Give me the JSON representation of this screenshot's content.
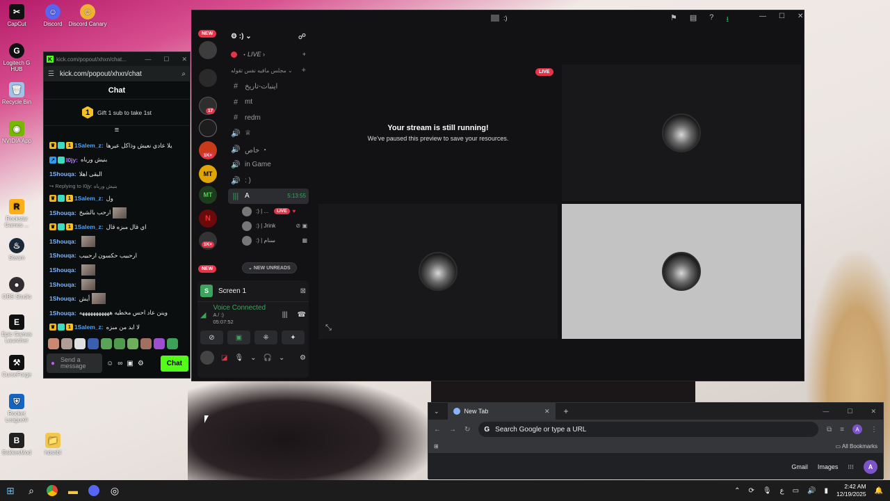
{
  "desktop": {
    "icons": [
      "CapCut",
      "Discord",
      "Discord Canary",
      "Logitech G HUB",
      "Recycle Bin",
      "NVIDIA App",
      "Rockstar Games ...",
      "Steam",
      "OBS Studio",
      "Epic Games Launcher",
      "CurseForge",
      "Rocket League®",
      "BakkesMod",
      "hdsnbl"
    ]
  },
  "kick": {
    "window_title": "kick.com/popout/xhxn/chat...",
    "url": "kick.com/popout/xhxn/chat",
    "chat_title": "Chat",
    "gift_count": "1",
    "gift_text": "Gift 1 sub to take 1st",
    "messages": [
      {
        "user": "1Salem_z:",
        "text": "يلا عادي نعيش وذاكل عيرها",
        "badges": true
      },
      {
        "user": "I0jy:",
        "text": "بنيش ورباه",
        "badges": true
      },
      {
        "user": "1Shouqa:",
        "text": "البقى اهلا"
      },
      {
        "user": "",
        "text": "Replying to I0jy: بنيش ورباه",
        "reply": true
      },
      {
        "user": "1Salem_z:",
        "text": "ول",
        "badges": true
      },
      {
        "user": "1Shouqa:",
        "text": "ارحب بالشيخ",
        "thumb": true
      },
      {
        "user": "1Salem_z:",
        "text": "اي قال مبزه قال",
        "badges": true
      },
      {
        "user": "1Shouqa:",
        "text": "",
        "thumb": true
      },
      {
        "user": "1Shouqa:",
        "text": "ارحبيب حكسون ارحبيب"
      },
      {
        "user": "1Shouqa:",
        "text": "",
        "thumb": true
      },
      {
        "user": "1Shouqa:",
        "text": "",
        "thumb": true
      },
      {
        "user": "1Shouqa:",
        "text": "أيش",
        "thumb": true
      },
      {
        "user": "1Shouqa:",
        "text": "وينن عاد احس مخطيه هههههههههههه"
      },
      {
        "user": "1Salem_z:",
        "text": "لا ابد من مبزه",
        "badges": true
      }
    ],
    "send_placeholder": "Send a message",
    "chat_button": "Chat"
  },
  "discord": {
    "window_title": ":)",
    "server_name": ":)",
    "new_label": "NEW",
    "live_channel": "LIVE",
    "category": "مجلس مافيه نفس تقوله",
    "channels": [
      {
        "sym": "#",
        "name": "اينبات-تاريخ"
      },
      {
        "sym": "#",
        "name": "mt"
      },
      {
        "sym": "#",
        "name": "redm"
      },
      {
        "sym": "🔊",
        "name": "♕"
      },
      {
        "sym": "🔊",
        "name": "خاص ・"
      },
      {
        "sym": "🔊",
        "name": "in Game"
      },
      {
        "sym": "🔊",
        "name": ": )"
      }
    ],
    "active_channel": {
      "name": "A",
      "time": "5:13:55"
    },
    "voice_users": [
      {
        "name": ":) | ...",
        "live": "LIVE"
      },
      {
        "name": ":) | Jrink"
      },
      {
        "name": ":) | سنام"
      }
    ],
    "new_unreads": "NEW UNREADS",
    "server_badges": [
      "17",
      "1K+",
      "1K+"
    ],
    "panel": {
      "screen_label": "Screen 1",
      "voice_status": "Voice Connected",
      "voice_channel": "A / :)",
      "voice_time": "05:07:52"
    },
    "stage": {
      "live_label": "LIVE",
      "stream_heading": "Your stream is still running!",
      "stream_sub": "We've paused this preview to save your resources."
    }
  },
  "chrome": {
    "tab_title": "New Tab",
    "omnibox_placeholder": "Search Google or type a URL",
    "all_bookmarks": "All Bookmarks",
    "gmail": "Gmail",
    "images": "Images",
    "profile_initial": "A"
  },
  "taskbar": {
    "time": "2:42 AM",
    "date": "12/19/2025",
    "lang": "ع"
  }
}
